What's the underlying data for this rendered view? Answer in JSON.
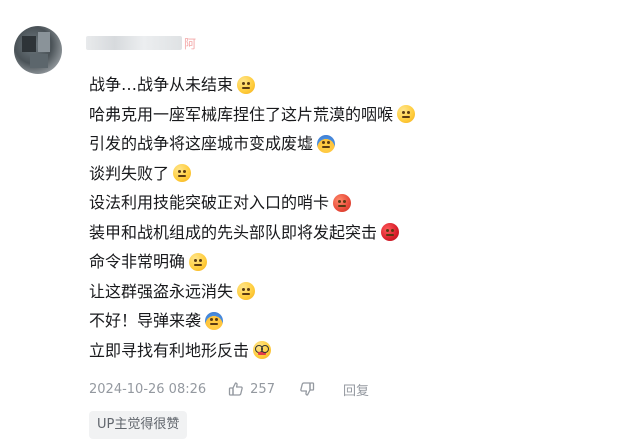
{
  "comment": {
    "username": "",
    "username_tail": "阿",
    "lines": [
      {
        "text": "战争…战争从未结束",
        "emoji": "sad-face-icon"
      },
      {
        "text": "哈弗克用一座军械库捏住了这片荒漠的咽喉",
        "emoji": "grimace-face-icon"
      },
      {
        "text": "引发的战争将这座城市变成废墟",
        "emoji": "scared-face-icon"
      },
      {
        "text": "谈判失败了",
        "emoji": "disappointed-face-icon"
      },
      {
        "text": "设法利用技能突破正对入口的哨卡",
        "emoji": "angry-face-icon"
      },
      {
        "text": "装甲和战机组成的先头部队即将发起突击",
        "emoji": "rage-face-icon"
      },
      {
        "text": "命令非常明确",
        "emoji": "blush-face-icon"
      },
      {
        "text": "让这群强盗永远消失",
        "emoji": "shush-face-icon"
      },
      {
        "text": "不好！导弹来袭",
        "emoji": "scared-face-icon"
      },
      {
        "text": "立即寻找有利地形反击",
        "emoji": "nerd-face-icon"
      }
    ],
    "timestamp": "2024-10-26 08:26",
    "like_count": "257",
    "reply_label": "回复",
    "badge": "UP主觉得很赞"
  }
}
